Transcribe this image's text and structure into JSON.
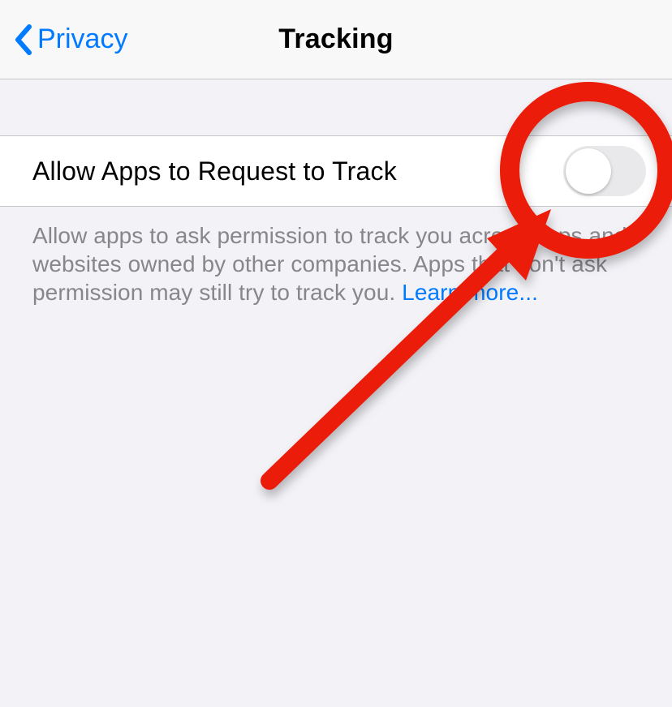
{
  "nav": {
    "back_label": "Privacy",
    "title": "Tracking"
  },
  "setting": {
    "label": "Allow Apps to Request to Track",
    "toggle_on": false
  },
  "footer": {
    "description": "Allow apps to ask permission to track you across apps and websites owned by other companies. Apps that don't ask permission may still try to track you. ",
    "learn_more_label": "Learn more..."
  }
}
